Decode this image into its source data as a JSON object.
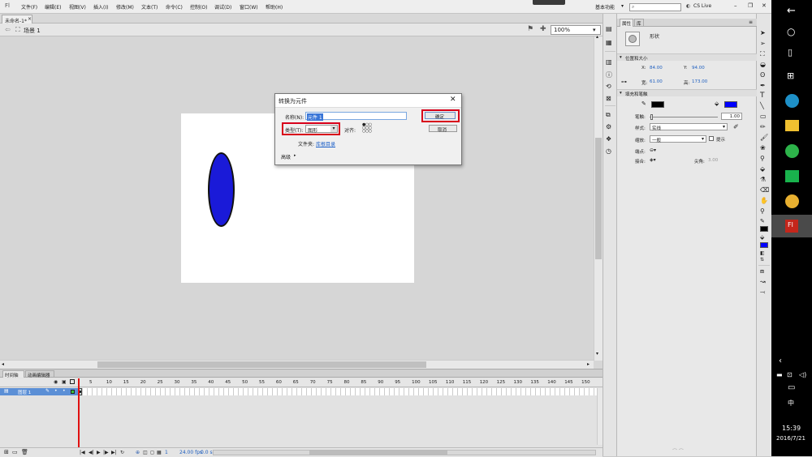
{
  "menubar": {
    "logo": "Fl",
    "items": [
      "文件(F)",
      "编辑(E)",
      "视图(V)",
      "插入(I)",
      "修改(M)",
      "文本(T)",
      "命令(C)",
      "控制(O)",
      "调试(D)",
      "窗口(W)",
      "帮助(H)"
    ],
    "workspace": "基本功能",
    "cs_live": "CS Live",
    "search_placeholder": ""
  },
  "document": {
    "tab": "未命名-1*"
  },
  "scene": {
    "label": "场景 1",
    "zoom": "100%"
  },
  "dialog": {
    "title": "转换为元件",
    "name_label": "名称(N):",
    "name_value": "元件 1",
    "ok_label": "确定",
    "cancel_label": "取消",
    "type_label": "类型(T):",
    "type_value": "图形",
    "align_label": "对齐:",
    "folder_label": "文件夹:",
    "folder_value": "库根目录",
    "advanced_label": "高级"
  },
  "timeline": {
    "tabs": [
      "时间轴",
      "动画编辑器"
    ],
    "layer_name": "图层 1",
    "frame_numbers": [
      "5",
      "10",
      "15",
      "20",
      "25",
      "30",
      "35",
      "40",
      "45",
      "50",
      "55",
      "60",
      "65",
      "70",
      "75",
      "80",
      "85",
      "90",
      "95",
      "100",
      "105",
      "110",
      "115",
      "120",
      "125",
      "130",
      "135",
      "140",
      "145",
      "150"
    ],
    "current_frame": "1",
    "fps": "24.00 fps",
    "time": "0.0 s"
  },
  "properties": {
    "tabs": [
      "属性",
      "库"
    ],
    "object_type": "形状",
    "section_position": "位置和大小",
    "x_label": "X:",
    "x_value": "84.00",
    "y_label": "Y:",
    "y_value": "94.00",
    "w_label": "宽:",
    "w_value": "61.00",
    "h_label": "高:",
    "h_value": "173.00",
    "section_fill": "填充和笔触",
    "stroke_color": "#000000",
    "fill_color": "#0000ff",
    "stroke_label": "笔触:",
    "stroke_value": "1.00",
    "style_label": "样式:",
    "style_value": "实线",
    "scale_label": "缩放:",
    "scale_value": "一般",
    "hint_label": "提示",
    "cap_label": "端点:",
    "join_label": "接合:",
    "miter_label": "尖角:",
    "miter_value": "3.00"
  },
  "taskbar": {
    "time": "15:39",
    "date": "2016/7/21",
    "ime": "中",
    "active_app": "Fl"
  },
  "colors": {
    "accent_red": "#d8001a",
    "ellipse_fill": "#1a1ad8"
  }
}
